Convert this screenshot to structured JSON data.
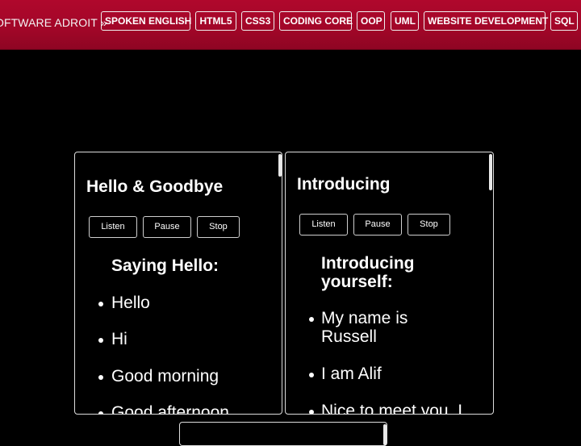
{
  "header": {
    "brand": "OFTWARE ADROIT »",
    "nav": [
      "SPOKEN ENGLISH",
      "HTML5",
      "CSS3",
      "CODING CORE",
      "OOP",
      "UML",
      "WEBSITE DEVELOPMENT",
      "SQL"
    ]
  },
  "cards": [
    {
      "title": "Hello & Goodbye",
      "controls": {
        "listen": "Listen",
        "pause": "Pause",
        "stop": "Stop"
      },
      "section": "Saying Hello:",
      "items": [
        "Hello",
        "Hi",
        "Good morning",
        "Good afternoon"
      ]
    },
    {
      "title": "Introducing",
      "controls": {
        "listen": "Listen",
        "pause": "Pause",
        "stop": "Stop"
      },
      "section": "Introducing yourself:",
      "items": [
        "My name is Russell",
        "I am Alif",
        "Nice to meet you. I"
      ]
    }
  ]
}
